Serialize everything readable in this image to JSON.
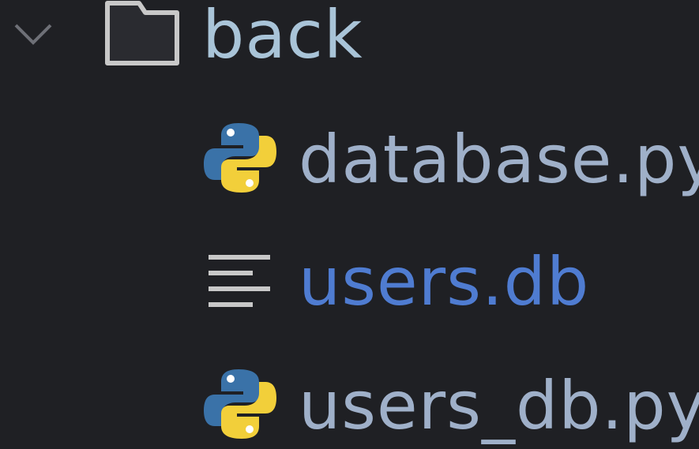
{
  "explorer": {
    "folder": {
      "name": "back",
      "expanded": true,
      "chevron_icon": "chevron-down-icon",
      "folder_icon": "folder-icon"
    },
    "files": [
      {
        "name": "database.py",
        "icon": "python-icon",
        "color": "#9fb0c9"
      },
      {
        "name": "users.db",
        "icon": "text-lines-icon",
        "color": "#4f7cd1"
      },
      {
        "name": "users_db.py",
        "icon": "python-icon",
        "color": "#9fb0c9"
      }
    ]
  },
  "colors": {
    "background": "#1f2024",
    "icon_gray": "#c8c8c8",
    "python_blue": "#3a72a8",
    "python_yellow": "#f2cf3a"
  }
}
